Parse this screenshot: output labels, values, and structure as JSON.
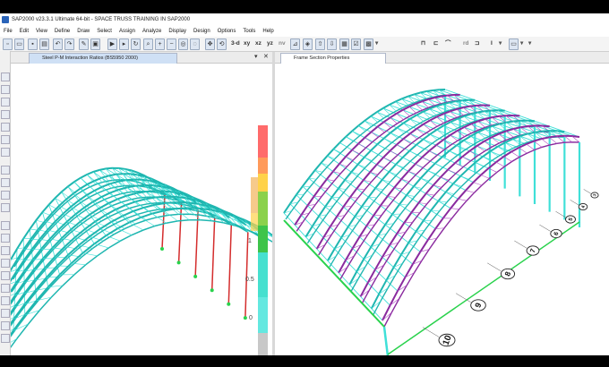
{
  "window": {
    "title": "SAP2000 v23.3.1 Ultimate 64-bit - SPACE TRUSS TRAINING IN SAP2000"
  },
  "menu": [
    "File",
    "Edit",
    "View",
    "Define",
    "Draw",
    "Select",
    "Assign",
    "Analyze",
    "Display",
    "Design",
    "Options",
    "Tools",
    "Help"
  ],
  "toolbar": {
    "view_xy": "xy",
    "view_xz": "xz",
    "view_yz": "yz",
    "view_nv": "nv",
    "view_3d": "3-d",
    "rd_label": "rd"
  },
  "left_panel": {
    "tab_label": "Steel P-M Interaction Ratios  (BS5950 2000)",
    "legend_values": [
      "1",
      "0.5",
      "0"
    ],
    "legend_colors": [
      "#ff6b6b",
      "#ff9a5a",
      "#ffd24a",
      "#8bd14b",
      "#3ec44a",
      "#46e0cf",
      "#64e8e0",
      "#c8c8c8"
    ]
  },
  "right_panel": {
    "tab_label": "Frame Section Properties",
    "gridline_labels": [
      "10",
      "9",
      "8",
      "7",
      "6",
      "5",
      "4",
      "3"
    ]
  },
  "colors": {
    "titlebar_bg": "#ffffff",
    "frame_cyan": "#3fe0d8",
    "frame_purple": "#8a2a9e",
    "frame_green": "#29d24c",
    "column_red": "#d42d2d"
  }
}
